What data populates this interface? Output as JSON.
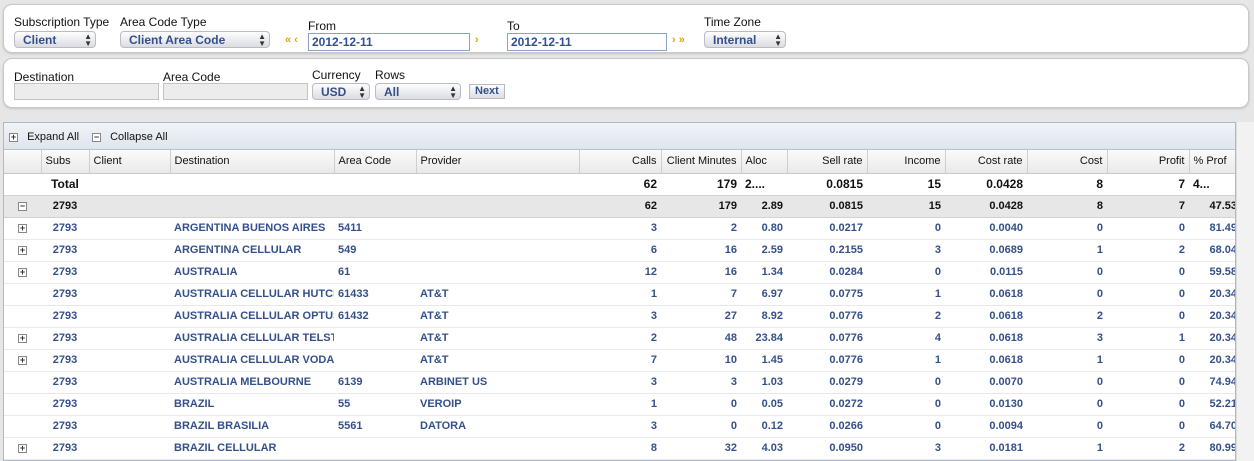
{
  "filters": {
    "subscription_type": {
      "label": "Subscription Type",
      "value": "Client"
    },
    "area_code_type": {
      "label": "Area Code Type",
      "value": "Client Area Code"
    },
    "from": {
      "label": "From",
      "value": "2012-12-11"
    },
    "to": {
      "label": "To",
      "value": "2012-12-11"
    },
    "time_zone": {
      "label": "Time Zone",
      "value": "Internal"
    },
    "prev_arrows": "«  ‹",
    "next_arrow": "›",
    "next_arrows": "›  »"
  },
  "filters2": {
    "destination_label": "Destination",
    "area_code_label": "Area Code",
    "currency": {
      "label": "Currency",
      "value": "USD"
    },
    "rows": {
      "label": "Rows",
      "value": "All"
    },
    "next_button": "Next"
  },
  "grid": {
    "expand_all": "Expand All",
    "collapse_all": "Collapse All",
    "columns": [
      "Subs",
      "Client",
      "Destination",
      "Area Code",
      "Provider",
      "Calls",
      "Client Minutes",
      "Aloc",
      "Sell rate",
      "Income",
      "Cost rate",
      "Cost",
      "Profit",
      "% Prof"
    ],
    "total": {
      "label": "Total",
      "calls": "62",
      "minutes": "179",
      "aloc": "2....",
      "sell_rate": "0.0815",
      "income": "15",
      "cost_rate": "0.0428",
      "cost": "8",
      "profit": "7",
      "pct": "4..."
    },
    "group": {
      "subs": "2793",
      "calls": "62",
      "minutes": "179",
      "aloc": "2.89",
      "sell_rate": "0.0815",
      "income": "15",
      "cost_rate": "0.0428",
      "cost": "8",
      "profit": "7",
      "pct": "47.53"
    },
    "rows": [
      {
        "expand": true,
        "subs": "2793",
        "destination": "ARGENTINA BUENOS AIRES",
        "area_code": "5411",
        "provider": "",
        "calls": "3",
        "minutes": "2",
        "aloc": "0.80",
        "sell_rate": "0.0217",
        "income": "0",
        "cost_rate": "0.0040",
        "cost": "0",
        "profit": "0",
        "pct": "81.49"
      },
      {
        "expand": true,
        "subs": "2793",
        "destination": "ARGENTINA CELLULAR",
        "area_code": "549",
        "provider": "",
        "calls": "6",
        "minutes": "16",
        "aloc": "2.59",
        "sell_rate": "0.2155",
        "income": "3",
        "cost_rate": "0.0689",
        "cost": "1",
        "profit": "2",
        "pct": "68.04"
      },
      {
        "expand": true,
        "subs": "2793",
        "destination": "AUSTRALIA",
        "area_code": "61",
        "provider": "",
        "calls": "12",
        "minutes": "16",
        "aloc": "1.34",
        "sell_rate": "0.0284",
        "income": "0",
        "cost_rate": "0.0115",
        "cost": "0",
        "profit": "0",
        "pct": "59.58"
      },
      {
        "expand": false,
        "subs": "2793",
        "destination": "AUSTRALIA CELLULAR HUTCH",
        "area_code": "61433",
        "provider": "AT&T",
        "calls": "1",
        "minutes": "7",
        "aloc": "6.97",
        "sell_rate": "0.0775",
        "income": "1",
        "cost_rate": "0.0618",
        "cost": "0",
        "profit": "0",
        "pct": "20.34"
      },
      {
        "expand": false,
        "subs": "2793",
        "destination": "AUSTRALIA CELLULAR OPTUS",
        "area_code": "61432",
        "provider": "AT&T",
        "calls": "3",
        "minutes": "27",
        "aloc": "8.92",
        "sell_rate": "0.0776",
        "income": "2",
        "cost_rate": "0.0618",
        "cost": "2",
        "profit": "0",
        "pct": "20.34"
      },
      {
        "expand": true,
        "subs": "2793",
        "destination": "AUSTRALIA CELLULAR TELSTRA",
        "area_code": "",
        "provider": "AT&T",
        "calls": "2",
        "minutes": "48",
        "aloc": "23.84",
        "sell_rate": "0.0776",
        "income": "4",
        "cost_rate": "0.0618",
        "cost": "3",
        "profit": "1",
        "pct": "20.34"
      },
      {
        "expand": true,
        "subs": "2793",
        "destination": "AUSTRALIA CELLULAR VODAFONE",
        "area_code": "",
        "provider": "AT&T",
        "calls": "7",
        "minutes": "10",
        "aloc": "1.45",
        "sell_rate": "0.0776",
        "income": "1",
        "cost_rate": "0.0618",
        "cost": "1",
        "profit": "0",
        "pct": "20.34"
      },
      {
        "expand": false,
        "subs": "2793",
        "destination": "AUSTRALIA MELBOURNE",
        "area_code": "6139",
        "provider": "ARBINET US",
        "calls": "3",
        "minutes": "3",
        "aloc": "1.03",
        "sell_rate": "0.0279",
        "income": "0",
        "cost_rate": "0.0070",
        "cost": "0",
        "profit": "0",
        "pct": "74.94"
      },
      {
        "expand": false,
        "subs": "2793",
        "destination": "BRAZIL",
        "area_code": "55",
        "provider": "VEROIP",
        "calls": "1",
        "minutes": "0",
        "aloc": "0.05",
        "sell_rate": "0.0272",
        "income": "0",
        "cost_rate": "0.0130",
        "cost": "0",
        "profit": "0",
        "pct": "52.21"
      },
      {
        "expand": false,
        "subs": "2793",
        "destination": "BRAZIL BRASILIA",
        "area_code": "5561",
        "provider": "DATORA",
        "calls": "3",
        "minutes": "0",
        "aloc": "0.12",
        "sell_rate": "0.0266",
        "income": "0",
        "cost_rate": "0.0094",
        "cost": "0",
        "profit": "0",
        "pct": "64.70"
      },
      {
        "expand": true,
        "subs": "2793",
        "destination": "BRAZIL CELLULAR",
        "area_code": "",
        "provider": "",
        "calls": "8",
        "minutes": "32",
        "aloc": "4.03",
        "sell_rate": "0.0950",
        "income": "3",
        "cost_rate": "0.0181",
        "cost": "1",
        "profit": "2",
        "pct": "80.99"
      }
    ]
  }
}
